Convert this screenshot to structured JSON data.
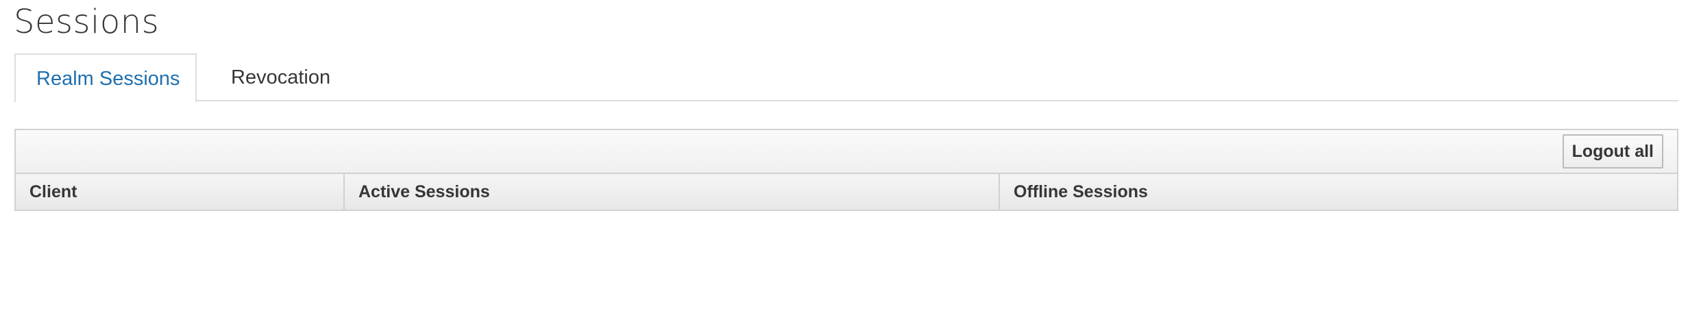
{
  "page": {
    "title": "Sessions"
  },
  "tabs": [
    {
      "label": "Realm Sessions",
      "active": true
    },
    {
      "label": "Revocation",
      "active": false
    }
  ],
  "toolbar": {
    "logout_all_label": "Logout all"
  },
  "table": {
    "columns": [
      "Client",
      "Active Sessions",
      "Offline Sessions"
    ],
    "rows": []
  },
  "colors": {
    "active_tab_text": "#1f6fae",
    "text": "#363636",
    "border": "#d1d1d1"
  }
}
